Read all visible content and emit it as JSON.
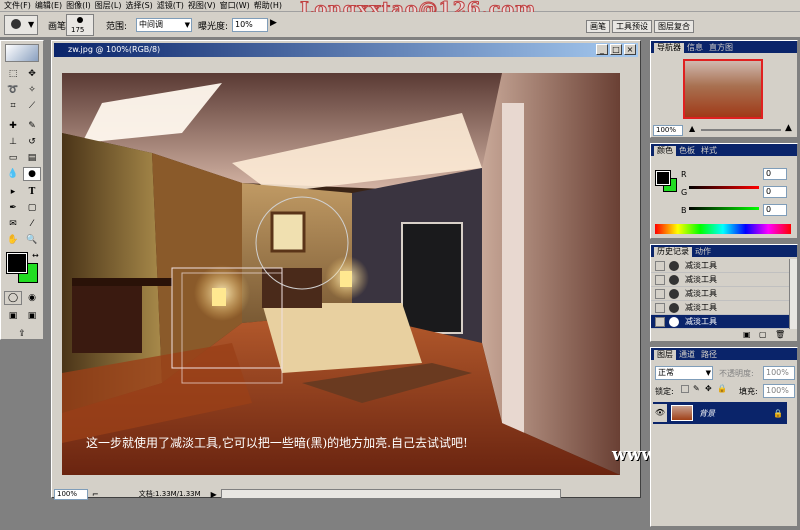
{
  "menu": [
    "文件(F)",
    "编辑(E)",
    "图像(I)",
    "图层(L)",
    "选择(S)",
    "滤镜(T)",
    "视图(V)",
    "窗口(W)",
    "帮助(H)"
  ],
  "watermark_top": "Longxxtao@126.com",
  "options": {
    "brush_label": "画笔:",
    "brush_size": "175",
    "range_label": "范围:",
    "range_value": "中间调",
    "exposure_label": "曝光度:",
    "exposure_value": "10%",
    "right_tabs": [
      "画笔",
      "工具预设",
      "图层复合"
    ]
  },
  "document": {
    "title": "zw.jpg @ 100%(RGB/8)",
    "zoom": "100%",
    "doc_size": "文档:1.33M/1.33M",
    "caption": "这一步就使用了减淡工具,它可以把一些暗(黑)的地方加亮.自己去试试吧!",
    "site_watermark": "www.snren.com"
  },
  "navigator": {
    "tabs": [
      "导航器",
      "信息",
      "直方图"
    ],
    "zoom": "100%"
  },
  "color": {
    "tabs": [
      "颜色",
      "色板",
      "样式"
    ],
    "channels": [
      {
        "label": "R",
        "value": "0"
      },
      {
        "label": "G",
        "value": "0"
      },
      {
        "label": "B",
        "value": "0"
      }
    ]
  },
  "history": {
    "tabs": [
      "历史记录",
      "动作"
    ],
    "items": [
      "减淡工具",
      "减淡工具",
      "减淡工具",
      "减淡工具",
      "减淡工具"
    ]
  },
  "layers": {
    "tabs": [
      "图层",
      "通道",
      "路径"
    ],
    "mode": "正常",
    "opacity_label": "不透明度:",
    "opacity": "100%",
    "lock_label": "锁定:",
    "fill_label": "填充:",
    "fill": "100%",
    "layer_name": "背景"
  },
  "colors": {
    "foreground": "#000000",
    "background": "#22dd22",
    "title_blue": "#0a246a"
  }
}
